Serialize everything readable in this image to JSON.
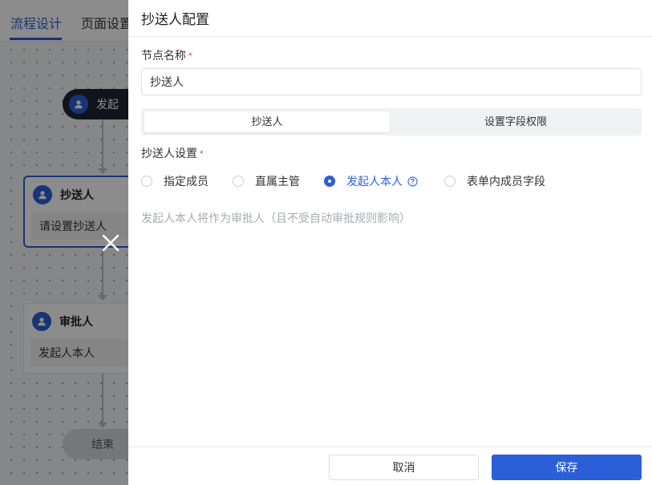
{
  "nav": {
    "tabs": [
      {
        "label": "流程设计",
        "active": true
      },
      {
        "label": "页面设置"
      }
    ]
  },
  "flow": {
    "start": {
      "label": "发起"
    },
    "nodes": [
      {
        "title": "抄送人",
        "value": "请设置抄送人",
        "selected": true
      },
      {
        "title": "审批人",
        "value": "发起人本人",
        "selected": false
      }
    ],
    "end": {
      "label": "结束"
    }
  },
  "drawer": {
    "title": "抄送人配置",
    "node_name_label": "节点名称",
    "node_name_value": "抄送人",
    "tabs": [
      {
        "label": "抄送人",
        "active": true
      },
      {
        "label": "设置字段权限",
        "active": false
      }
    ],
    "cc_setting_label": "抄送人设置",
    "required_mark": "*",
    "options": [
      {
        "label": "指定成员",
        "checked": false
      },
      {
        "label": "直属主管",
        "checked": false
      },
      {
        "label": "发起人本人",
        "checked": true,
        "help_icon": "question-circle-icon"
      },
      {
        "label": "表单内成员字段",
        "checked": false
      }
    ],
    "hint": "发起人本人将作为审批人（且不受自动审批规则影响）",
    "cancel_label": "取消",
    "save_label": "保存"
  },
  "colors": {
    "primary": "#2b5fd9",
    "required": "#e34d4d",
    "overlay": "rgba(0,0,0,0.45)"
  }
}
